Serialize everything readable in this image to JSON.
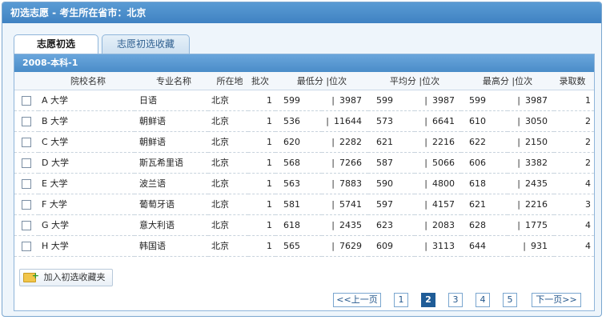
{
  "window": {
    "title": "初选志愿 - 考生所在省市：北京"
  },
  "tabs": [
    {
      "label": "志愿初选",
      "active": true
    },
    {
      "label": "志愿初选收藏",
      "active": false
    }
  ],
  "group": {
    "label": "2008-本科-1"
  },
  "table": {
    "headers": [
      "",
      "院校名称",
      "专业名称",
      "所在地",
      "批次",
      "最低分 |位次",
      "平均分 |位次",
      "最高分 |位次",
      "录取数"
    ],
    "rows": [
      {
        "school": "A 大学",
        "major": "日语",
        "location": "北京",
        "batch": "1",
        "min_score": "599",
        "min_rank": "3987",
        "avg_score": "599",
        "avg_rank": "3987",
        "max_score": "599",
        "max_rank": "3987",
        "count": "1"
      },
      {
        "school": "B 大学",
        "major": "朝鲜语",
        "location": "北京",
        "batch": "1",
        "min_score": "536",
        "min_rank": "11644",
        "avg_score": "573",
        "avg_rank": "6641",
        "max_score": "610",
        "max_rank": "3050",
        "count": "2"
      },
      {
        "school": "C 大学",
        "major": "朝鲜语",
        "location": "北京",
        "batch": "1",
        "min_score": "620",
        "min_rank": "2282",
        "avg_score": "621",
        "avg_rank": "2216",
        "max_score": "622",
        "max_rank": "2150",
        "count": "2"
      },
      {
        "school": "D 大学",
        "major": "斯瓦希里语",
        "location": "北京",
        "batch": "1",
        "min_score": "568",
        "min_rank": "7266",
        "avg_score": "587",
        "avg_rank": "5066",
        "max_score": "606",
        "max_rank": "3382",
        "count": "2"
      },
      {
        "school": "E 大学",
        "major": "波兰语",
        "location": "北京",
        "batch": "1",
        "min_score": "563",
        "min_rank": "7883",
        "avg_score": "590",
        "avg_rank": "4800",
        "max_score": "618",
        "max_rank": "2435",
        "count": "4"
      },
      {
        "school": "F 大学",
        "major": "葡萄牙语",
        "location": "北京",
        "batch": "1",
        "min_score": "581",
        "min_rank": "5741",
        "avg_score": "597",
        "avg_rank": "4157",
        "max_score": "621",
        "max_rank": "2216",
        "count": "3"
      },
      {
        "school": "G 大学",
        "major": "意大利语",
        "location": "北京",
        "batch": "1",
        "min_score": "618",
        "min_rank": "2435",
        "avg_score": "623",
        "avg_rank": "2083",
        "max_score": "628",
        "max_rank": "1775",
        "count": "4"
      },
      {
        "school": "H 大学",
        "major": "韩国语",
        "location": "北京",
        "batch": "1",
        "min_score": "565",
        "min_rank": "7629",
        "avg_score": "609",
        "avg_rank": "3113",
        "max_score": "644",
        "max_rank": "931",
        "count": "4"
      }
    ]
  },
  "actions": {
    "add_favorite_label": "加入初选收藏夹"
  },
  "pager": {
    "prev_label": "<<上一页",
    "next_label": "下一页>>",
    "pages": [
      "1",
      "2",
      "3",
      "4",
      "5"
    ],
    "current": "2"
  },
  "icons": {
    "checkbox": "checkbox-icon",
    "add_folder": "folder-add-icon"
  }
}
